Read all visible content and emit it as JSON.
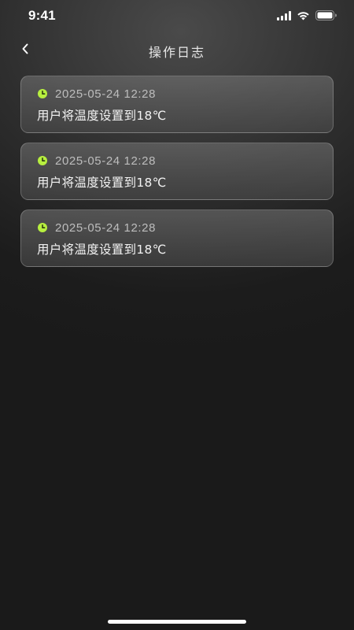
{
  "status_bar": {
    "time": "9:41"
  },
  "nav": {
    "title": "操作日志",
    "back_icon": "chevron-left-icon"
  },
  "logs": [
    {
      "time": "2025-05-24 12:28",
      "text": "用户将温度设置到18℃"
    },
    {
      "time": "2025-05-24 12:28",
      "text": "用户将温度设置到18℃"
    },
    {
      "time": "2025-05-24 12:28",
      "text": "用户将温度设置到18℃"
    }
  ],
  "colors": {
    "accent": "#b7ef3f",
    "background": "#1b1b1b"
  }
}
